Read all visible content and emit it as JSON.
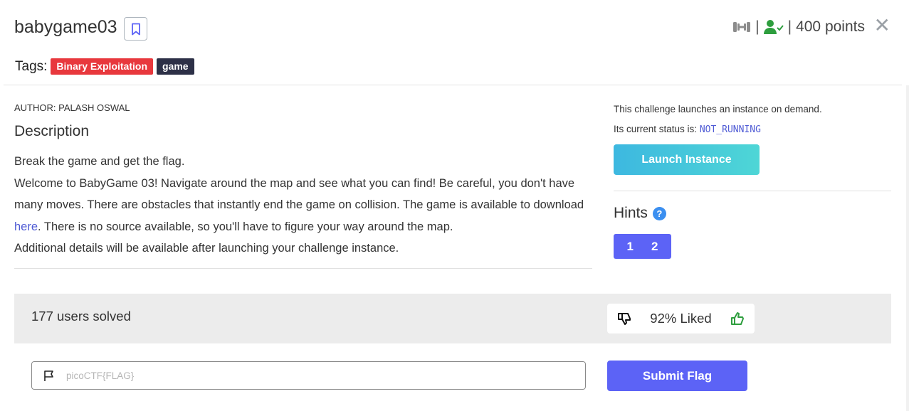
{
  "challenge": {
    "title": "babygame03",
    "points": "400 points",
    "separator": "|",
    "tags_label": "Tags:",
    "tags": [
      "Binary Exploitation",
      "game"
    ]
  },
  "description": {
    "author": "AUTHOR: PALASH OSWAL",
    "heading": "Description",
    "line1": "Break the game and get the flag.",
    "line2": "Welcome to BabyGame 03! Navigate around the map and see what you can find! Be careful, you don't have many moves. There are obstacles that instantly end the game on collision. The game is available to download",
    "link_text": "here",
    "line2_after": ". There is no source available, so you'll have to figure your way around the map.",
    "line3": "Additional details will be available after launching your challenge instance."
  },
  "instance": {
    "text1": "This challenge launches an instance on demand.",
    "status_prefix": "Its current status is:",
    "status": "NOT_RUNNING",
    "launch_label": "Launch Instance"
  },
  "hints": {
    "title": "Hints",
    "help_glyph": "?",
    "items": [
      "1",
      "2"
    ]
  },
  "stats": {
    "solved": "177 users solved",
    "liked": "92% Liked"
  },
  "flag": {
    "placeholder": "picoCTF{FLAG}",
    "value": "",
    "submit_label": "Submit Flag"
  },
  "icons": {
    "difficulty": "dumbbell-icon",
    "solved_user": "user-check-icon",
    "close": "close-icon",
    "bookmark": "bookmark-icon",
    "thumbs_down": "thumbs-down-icon",
    "thumbs_up": "thumbs-up-icon",
    "flag": "flag-icon"
  },
  "colors": {
    "tag_binary": "#e8383d",
    "tag_game": "#2d3047",
    "accent": "#5c63f6",
    "link": "#4f5bd5",
    "user_check": "#2e9e3e"
  }
}
